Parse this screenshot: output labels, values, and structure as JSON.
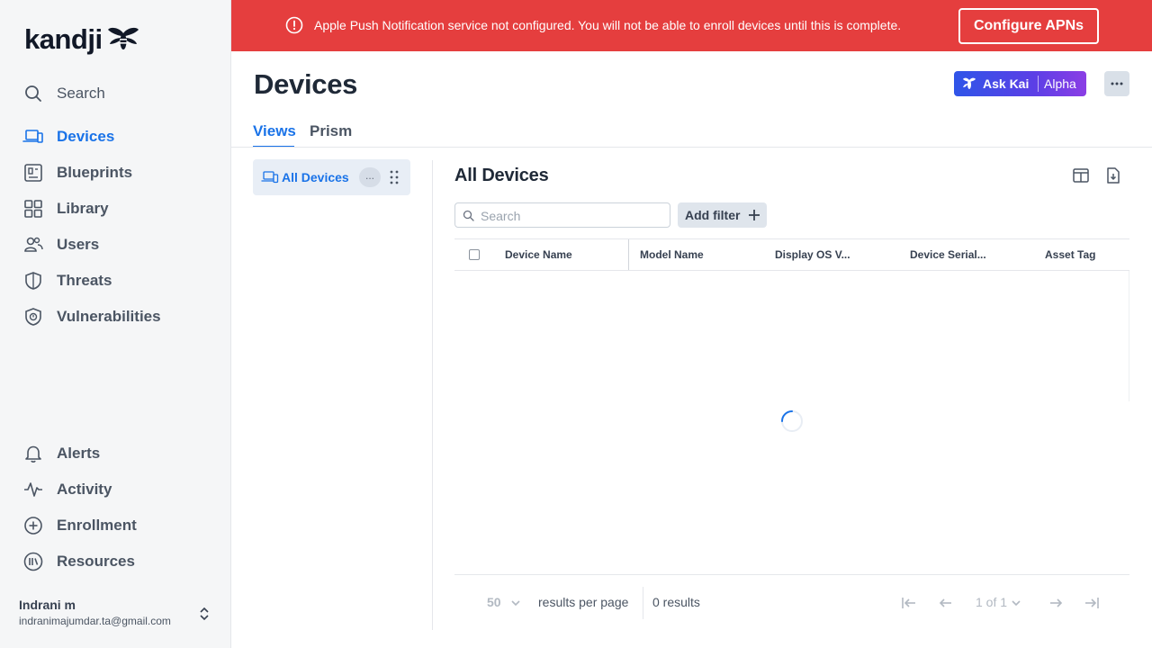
{
  "sidebar": {
    "logo": "kandji",
    "search_label": "Search",
    "items": [
      {
        "label": "Devices",
        "icon": "devices-icon",
        "active": true
      },
      {
        "label": "Blueprints",
        "icon": "blueprints-icon"
      },
      {
        "label": "Library",
        "icon": "library-icon"
      },
      {
        "label": "Users",
        "icon": "users-icon"
      },
      {
        "label": "Threats",
        "icon": "threats-icon"
      },
      {
        "label": "Vulnerabilities",
        "icon": "vulnerabilities-icon"
      }
    ],
    "bottom_items": [
      {
        "label": "Alerts",
        "icon": "bell-icon"
      },
      {
        "label": "Activity",
        "icon": "activity-icon"
      },
      {
        "label": "Enrollment",
        "icon": "plus-circle-icon"
      },
      {
        "label": "Resources",
        "icon": "resources-icon"
      }
    ],
    "user": {
      "name": "Indrani m",
      "email": "indranimajumdar.ta@gmail.com"
    }
  },
  "banner": {
    "message": "Apple Push Notification service not configured. You will not be able to enroll devices until this is complete.",
    "button": "Configure APNs",
    "color": "#e53e3e"
  },
  "header": {
    "title": "Devices",
    "ask_kai": "Ask Kai",
    "alpha": "Alpha",
    "more": "..."
  },
  "tabs": [
    {
      "label": "Views",
      "active": true
    },
    {
      "label": "Prism"
    }
  ],
  "views": {
    "item_label": "All Devices",
    "more": "..."
  },
  "list": {
    "title": "All Devices",
    "search_placeholder": "Search",
    "add_filter": "Add filter",
    "columns": [
      "Device Name",
      "Model Name",
      "Display OS V...",
      "Device Serial...",
      "Asset Tag"
    ]
  },
  "footer": {
    "per_page_value": "50",
    "per_page_label": "results per page",
    "results": "0 results",
    "page_label": "1 of 1"
  },
  "colors": {
    "accent": "#1a73e8",
    "banner": "#e53e3e"
  }
}
